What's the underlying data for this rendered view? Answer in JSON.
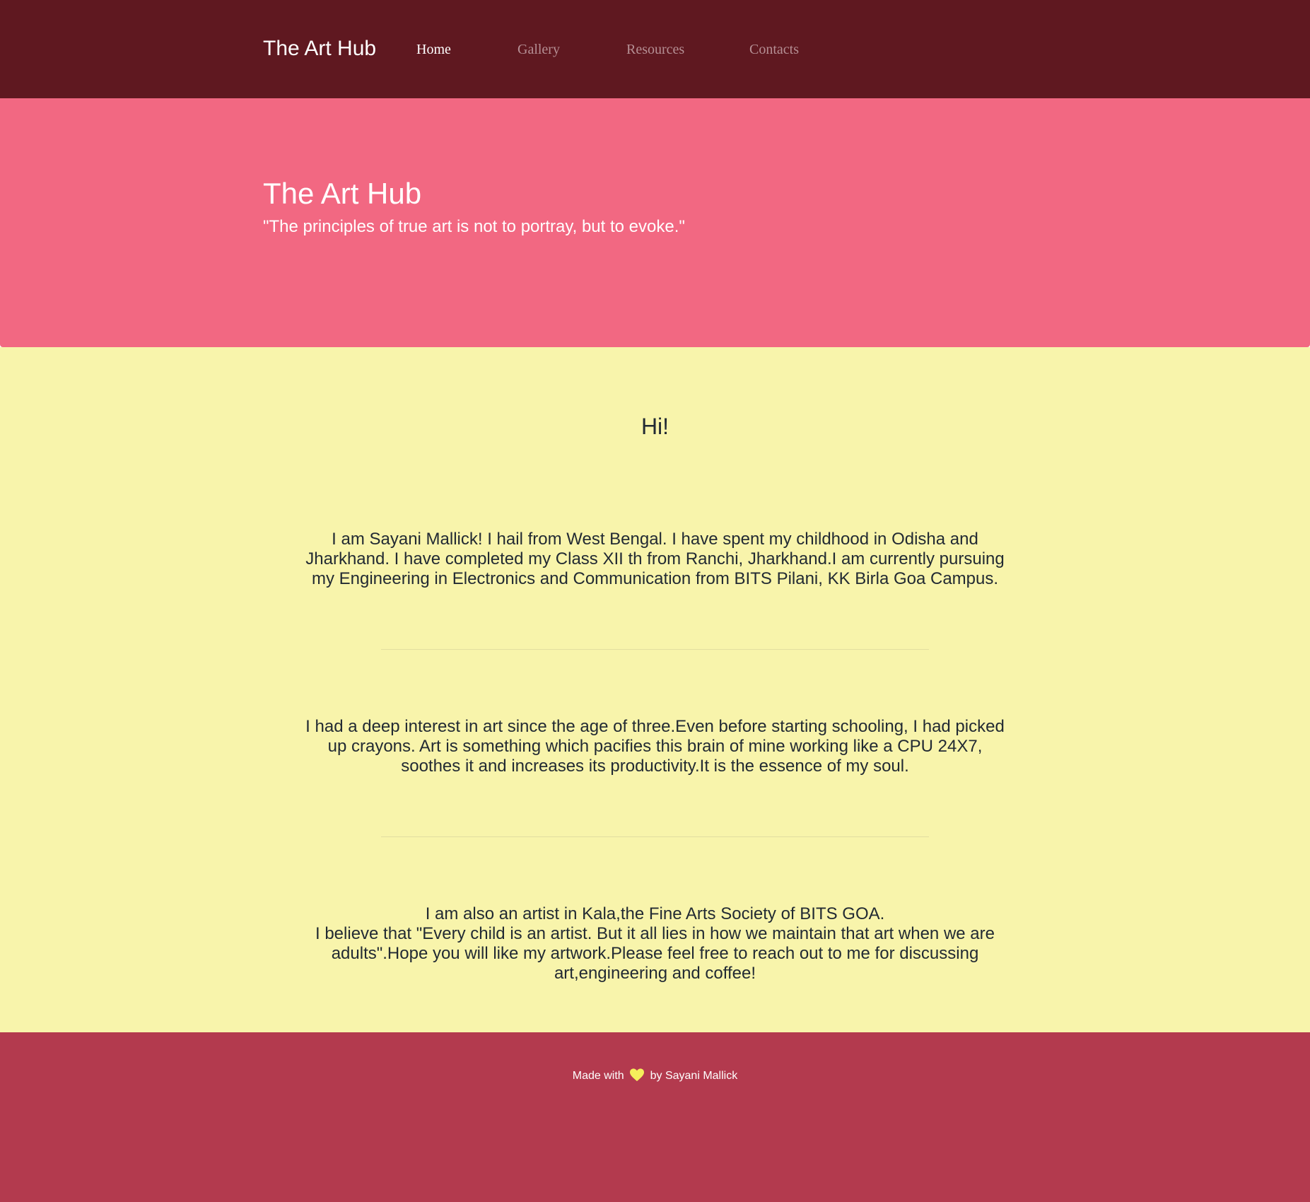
{
  "navbar": {
    "brand": "The Art Hub",
    "links": [
      {
        "label": "Home",
        "active": true
      },
      {
        "label": "Gallery",
        "active": false
      },
      {
        "label": "Resources",
        "active": false
      },
      {
        "label": "Contacts",
        "active": false
      }
    ]
  },
  "hero": {
    "title": "The Art Hub",
    "quote": "\"The principles of true art is not to portray, but to evoke.\""
  },
  "main": {
    "greeting": "Hi!",
    "paragraphs": [
      "I am Sayani Mallick! I hail from West Bengal. I have spent my childhood in Odisha and Jharkhand. I have completed my Class XII th from Ranchi, Jharkhand.I am currently pursuing my Engineering in Electronics and Communication from BITS Pilani, KK Birla Goa Campus.",
      "I had a deep interest in art since the age of three.Even before starting schooling, I had picked up crayons. Art is something which pacifies this brain of mine working like a CPU 24X7, soothes it and increases its productivity.It is the essence of my soul."
    ],
    "closing_line1": "I am also an artist in Kala,the Fine Arts Society of BITS GOA.",
    "closing_line2": "I believe that \"Every child is an artist. But it all lies in how we maintain that art when we are adults\".Hope you will like my artwork.Please feel free to reach out to me for discussing art,engineering and coffee!"
  },
  "footer": {
    "prefix": "Made with",
    "icon": "heart-icon",
    "suffix": "by Sayani Mallick"
  },
  "colors": {
    "navbar_bg": "#5f1820",
    "hero_bg": "#f26882",
    "main_bg": "#f8f4ab",
    "footer_bg": "#b33a4e",
    "heart": "#f5ef5b"
  }
}
